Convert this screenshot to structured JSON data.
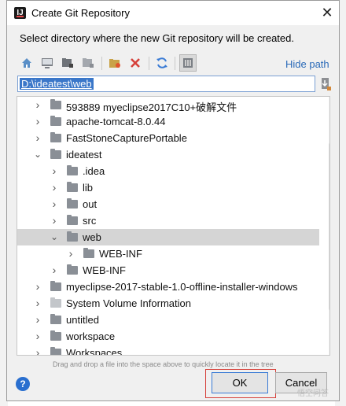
{
  "dialog": {
    "title": "Create Git Repository",
    "description": "Select directory where the new Git repository will be created.",
    "hide_path_label": "Hide path",
    "path_value": "D:\\ideatest\\web",
    "hint": "Drag and drop a file into the space above to quickly locate it in the tree",
    "ok_label": "OK",
    "cancel_label": "Cancel",
    "help_glyph": "?",
    "close_glyph": "✕"
  },
  "toolbar": {
    "icons": [
      "home-icon",
      "desktop-icon",
      "project-icon",
      "module-icon",
      "new-folder-icon",
      "delete-icon",
      "refresh-icon",
      "show-hidden-icon"
    ]
  },
  "tree": {
    "rows": [
      {
        "label": "593889 myeclipse2017C10+破解文件",
        "expanded": false,
        "depth": 0,
        "folder": "dark"
      },
      {
        "label": "apache-tomcat-8.0.44",
        "expanded": false,
        "depth": 0,
        "folder": "dark"
      },
      {
        "label": "FastStoneCapturePortable",
        "expanded": false,
        "depth": 0,
        "folder": "dark"
      },
      {
        "label": "ideatest",
        "expanded": true,
        "depth": 0,
        "folder": "dark"
      },
      {
        "label": ".idea",
        "expanded": false,
        "depth": 1,
        "folder": "dark"
      },
      {
        "label": "lib",
        "expanded": false,
        "depth": 1,
        "folder": "dark"
      },
      {
        "label": "out",
        "expanded": false,
        "depth": 1,
        "folder": "dark"
      },
      {
        "label": "src",
        "expanded": false,
        "depth": 1,
        "folder": "dark"
      },
      {
        "label": "web",
        "expanded": true,
        "depth": 1,
        "folder": "dark",
        "selected": true
      },
      {
        "label": "WEB-INF",
        "expanded": false,
        "depth": 2,
        "folder": "dark"
      },
      {
        "label": "WEB-INF",
        "expanded": false,
        "depth": 1,
        "folder": "dark"
      },
      {
        "label": "myeclipse-2017-stable-1.0-offline-installer-windows",
        "expanded": false,
        "depth": 0,
        "folder": "dark"
      },
      {
        "label": "System Volume Information",
        "expanded": false,
        "depth": 0,
        "folder": "light"
      },
      {
        "label": "untitled",
        "expanded": false,
        "depth": 0,
        "folder": "dark"
      },
      {
        "label": "workspace",
        "expanded": false,
        "depth": 0,
        "folder": "dark"
      },
      {
        "label": "Workspaces",
        "expanded": false,
        "depth": 0,
        "folder": "dark"
      }
    ]
  },
  "background": {
    "watermark": "悟空问答"
  },
  "colors": {
    "accent": "#2a6ab8",
    "selection": "#d5d5d5",
    "highlight_frame": "#d6403a",
    "path_selection": "#3a77c9"
  }
}
